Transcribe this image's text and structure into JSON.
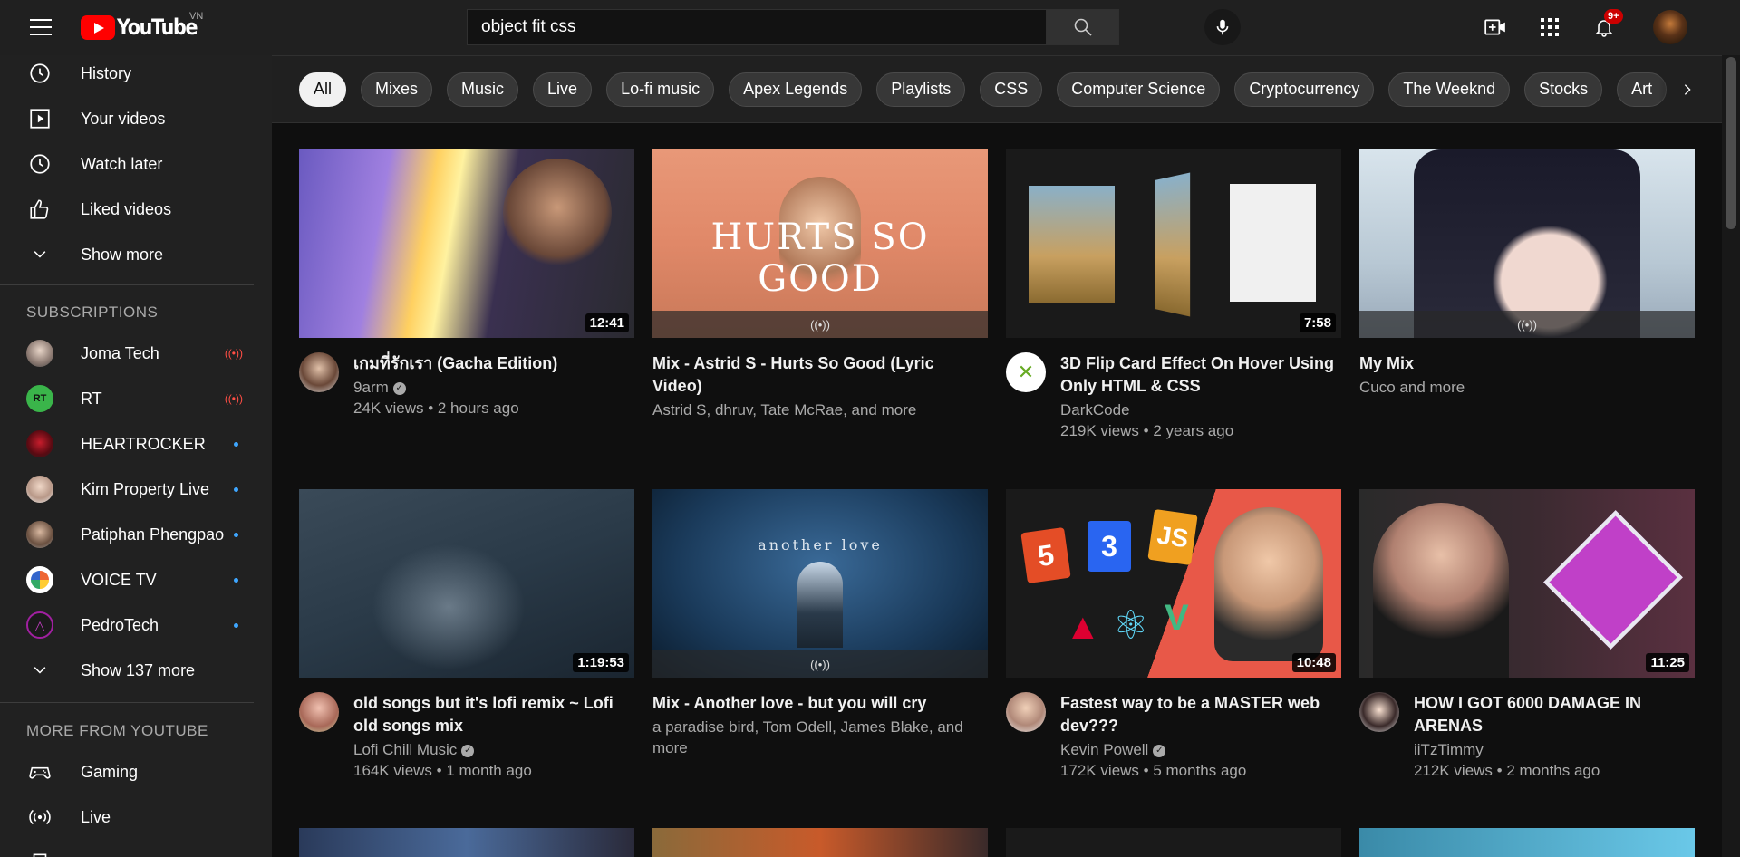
{
  "header": {
    "logo_text": "YouTube",
    "country": "VN",
    "search_value": "object fit css",
    "notification_count": "9+"
  },
  "sidebar": {
    "library": [
      {
        "label": "History",
        "icon": "history-icon"
      },
      {
        "label": "Your videos",
        "icon": "your-videos-icon"
      },
      {
        "label": "Watch later",
        "icon": "watch-later-icon"
      },
      {
        "label": "Liked videos",
        "icon": "thumbs-up-icon"
      },
      {
        "label": "Show more",
        "icon": "chevron-down-icon"
      }
    ],
    "subscriptions_heading": "SUBSCRIPTIONS",
    "subscriptions": [
      {
        "label": "Joma Tech",
        "status": "live"
      },
      {
        "label": "RT",
        "status": "live"
      },
      {
        "label": "HEARTROCKER",
        "status": "new"
      },
      {
        "label": "Kim Property Live",
        "status": "new"
      },
      {
        "label": "Patiphan Phengpao",
        "status": "new"
      },
      {
        "label": "VOICE TV",
        "status": "new"
      },
      {
        "label": "PedroTech",
        "status": "new"
      }
    ],
    "show_more_subs": "Show 137 more",
    "more_heading": "MORE FROM YOUTUBE",
    "more": [
      {
        "label": "Gaming",
        "icon": "gaming-icon"
      },
      {
        "label": "Live",
        "icon": "live-icon"
      }
    ]
  },
  "chips": [
    "All",
    "Mixes",
    "Music",
    "Live",
    "Lo-fi music",
    "Apex Legends",
    "Playlists",
    "CSS",
    "Computer Science",
    "Cryptocurrency",
    "The Weeknd",
    "Stocks",
    "Art"
  ],
  "videos": [
    {
      "title": "เกมที่รักเรา (Gacha Edition)",
      "channel": "9arm",
      "verified": true,
      "stats": "24K views • 2 hours ago",
      "duration": "12:41"
    },
    {
      "title": "Mix - Astrid S - Hurts So Good (Lyric Video)",
      "channel": "Astrid S, dhruv, Tate McRae, and more",
      "verified": false,
      "stats": "",
      "mix": true,
      "thumb_text": "HURTS SO GOOD"
    },
    {
      "title": "3D Flip Card Effect On Hover Using Only HTML & CSS",
      "channel": "DarkCode",
      "verified": false,
      "stats": "219K views • 2 years ago",
      "duration": "7:58"
    },
    {
      "title": "My Mix",
      "channel": "Cuco and more",
      "verified": false,
      "stats": "",
      "mix": true
    },
    {
      "title": "old songs but it's lofi remix ~ Lofi old songs mix",
      "channel": "Lofi Chill Music",
      "verified": true,
      "stats": "164K views • 1 month ago",
      "duration": "1:19:53"
    },
    {
      "title": "Mix - Another love - but you will cry",
      "channel": "a paradise bird, Tom Odell, James Blake, and more",
      "verified": false,
      "stats": "",
      "mix": true,
      "thumb_text": "another love"
    },
    {
      "title": "Fastest way to be a MASTER web dev???",
      "channel": "Kevin Powell",
      "verified": true,
      "stats": "172K views • 5 months ago",
      "duration": "10:48"
    },
    {
      "title": "HOW I GOT 6000 DAMAGE IN ARENAS",
      "channel": "iiTzTimmy",
      "verified": false,
      "stats": "212K views • 2 months ago",
      "duration": "11:25"
    }
  ]
}
